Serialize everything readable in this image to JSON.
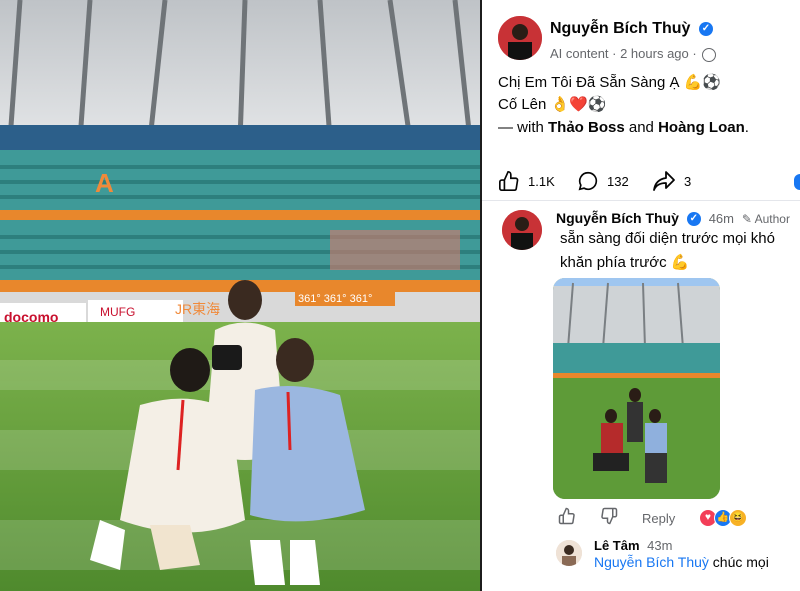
{
  "post": {
    "author": "Nguyễn Bích Thuỳ",
    "meta": "AI content · 2 hours ago ·",
    "caption_line1": "Chị Em Tôi Đã Sẵn Sàng Ạ 💪⚽",
    "caption_line2": "Cố Lên 👌❤️⚽",
    "with_prefix": "— with ",
    "with_name1": "Thảo Boss",
    "with_and": " and ",
    "with_name2": "Hoàng Loan",
    "with_suffix": ".",
    "likes": "1.1K",
    "comments": "132",
    "shares": "3"
  },
  "comment": {
    "author": "Nguyễn Bích Thuỳ",
    "time": "46m",
    "author_badge": "Author",
    "text": "sẵn sàng đối diện trước mọi khó khăn phía trước 💪",
    "reply_label": "Reply"
  },
  "reply": {
    "author": "Lê Tâm",
    "time": "43m",
    "mention": "Nguyễn Bích Thuỳ",
    "text": " chúc mọi"
  },
  "photo": {
    "stadium_sign_1": "docomo",
    "stadium_sign_2": "MUFG",
    "stadium_sign_3": "JR東海",
    "stadium_sign_4": "361° 361° 361°",
    "stadium_letter": "A"
  },
  "icons": {
    "verified": "check-badge-icon",
    "globe": "globe-icon",
    "like": "thumb-up-icon",
    "comment": "comment-bubble-icon",
    "share": "share-arrow-icon",
    "dislike": "thumb-down-icon",
    "pencil": "pencil-icon"
  },
  "colors": {
    "accent": "#1877f2",
    "muted": "#65676b",
    "grass": "#6da543"
  }
}
